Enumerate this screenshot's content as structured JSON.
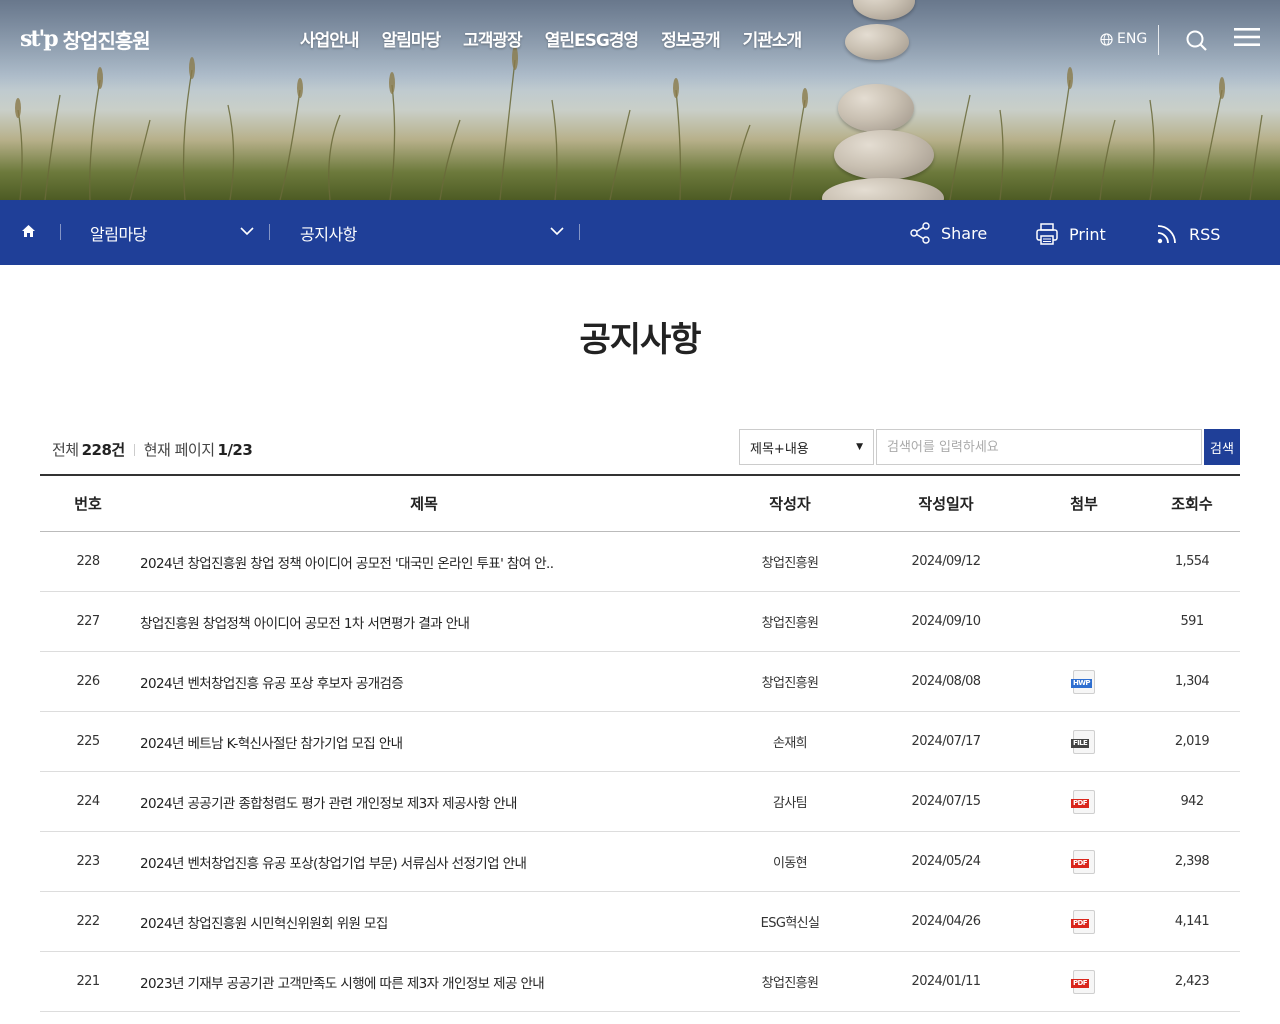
{
  "header": {
    "logo_mark": "ѕt'p",
    "logo_text": "창업진흥원",
    "gnb": [
      "사업안내",
      "알림마당",
      "고객광장",
      "열린ESG경영",
      "정보공개",
      "기관소개"
    ],
    "lang_label": "ENG"
  },
  "subnav": {
    "depth1": "알림마당",
    "depth2": "공지사항",
    "share_label": "Share",
    "print_label": "Print",
    "rss_label": "RSS"
  },
  "page": {
    "title": "공지사항"
  },
  "board_meta": {
    "total_label": "전체",
    "total_value": "228건",
    "page_label": "현재 페이지",
    "page_value": "1/23"
  },
  "search": {
    "scope_value": "제목+내용",
    "placeholder": "검색어를 입력하세요",
    "button_label": "검색"
  },
  "table": {
    "headers": {
      "no": "번호",
      "title": "제목",
      "writer": "작성자",
      "date": "작성일자",
      "file": "첨부",
      "views": "조회수"
    },
    "rows": [
      {
        "no": "228",
        "title": "2024년 창업진흥원 창업 정책 아이디어 공모전 '대국민 온라인 투표' 참여 안..",
        "writer": "창업진흥원",
        "date": "2024/09/12",
        "file": "",
        "views": "1,554"
      },
      {
        "no": "227",
        "title": "창업진흥원 창업정책 아이디어 공모전 1차 서면평가 결과 안내",
        "writer": "창업진흥원",
        "date": "2024/09/10",
        "file": "",
        "views": "591"
      },
      {
        "no": "226",
        "title": "2024년 벤처창업진흥 유공 포상 후보자 공개검증",
        "writer": "창업진흥원",
        "date": "2024/08/08",
        "file": "HWP",
        "views": "1,304"
      },
      {
        "no": "225",
        "title": "2024년 베트남 K-혁신사절단 참가기업 모집 안내",
        "writer": "손재희",
        "date": "2024/07/17",
        "file": "FILE",
        "views": "2,019"
      },
      {
        "no": "224",
        "title": "2024년 공공기관 종합청렴도 평가 관련 개인정보 제3자 제공사항 안내",
        "writer": "감사팀",
        "date": "2024/07/15",
        "file": "PDF",
        "views": "942"
      },
      {
        "no": "223",
        "title": "2024년 벤처창업진흥 유공 포상(창업기업 부문) 서류심사 선정기업 안내",
        "writer": "이동현",
        "date": "2024/05/24",
        "file": "PDF",
        "views": "2,398"
      },
      {
        "no": "222",
        "title": "2024년 창업진흥원 시민혁신위원회 위원 모집",
        "writer": "ESG혁신실",
        "date": "2024/04/26",
        "file": "PDF",
        "views": "4,141"
      },
      {
        "no": "221",
        "title": "2023년 기재부 공공기관 고객만족도 시행에 따른 제3자 개인정보 제공 안내",
        "writer": "창업진흥원",
        "date": "2024/01/11",
        "file": "PDF",
        "views": "2,423"
      }
    ]
  },
  "colors": {
    "brand_blue": "#1f3f98",
    "pdf_red": "#d9261c",
    "hwp_blue": "#2f6fd0",
    "file_gray": "#444444"
  }
}
